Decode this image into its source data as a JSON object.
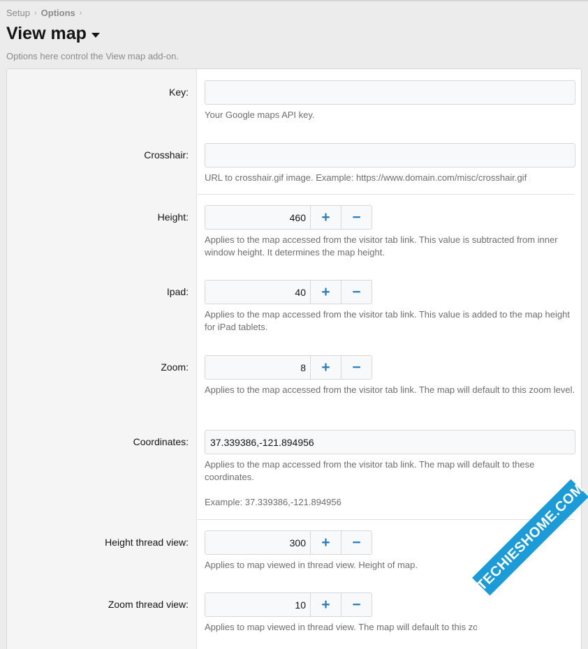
{
  "breadcrumb": {
    "items": [
      "Setup",
      "Options"
    ],
    "separator": "›"
  },
  "header": {
    "title": "View map",
    "description": "Options here control the View map add-on."
  },
  "fields": {
    "key": {
      "label": "Key:",
      "value": "",
      "hint": "Your Google maps API key."
    },
    "crosshair": {
      "label": "Crosshair:",
      "value": "",
      "hint": "URL to crosshair.gif image. Example: https://www.domain.com/misc/crosshair.gif"
    },
    "height": {
      "label": "Height:",
      "value": "460",
      "hint": "Applies to the map accessed from the visitor tab link. This value is subtracted from inner window height. It determines the map height."
    },
    "ipad": {
      "label": "Ipad:",
      "value": "40",
      "hint": "Applies to the map accessed from the visitor tab link. This value is added to the map height for iPad tablets."
    },
    "zoom": {
      "label": "Zoom:",
      "value": "8",
      "hint": "Applies to the map accessed from the visitor tab link. The map will default to this zoom level."
    },
    "coordinates": {
      "label": "Coordinates:",
      "value": "37.339386,-121.894956",
      "hint": "Applies to the map accessed from the visitor tab link. The map will default to these coordinates.",
      "example": "Example: 37.339386,-121.894956"
    },
    "height_thread_view": {
      "label": "Height thread view:",
      "value": "300",
      "hint": "Applies to map viewed in thread view. Height of map."
    },
    "zoom_thread_view": {
      "label": "Zoom thread view:",
      "value": "10",
      "hint": "Applies to map viewed in thread view. The map will default to this zoo"
    }
  },
  "stepper": {
    "increment_symbol": "+",
    "decrement_symbol": "−"
  },
  "watermark": {
    "text_part1": "TECHIES",
    "text_part2": "HOME.COM"
  },
  "colors": {
    "accent": "#2b7fc5",
    "watermark": "#1b9bd8"
  }
}
